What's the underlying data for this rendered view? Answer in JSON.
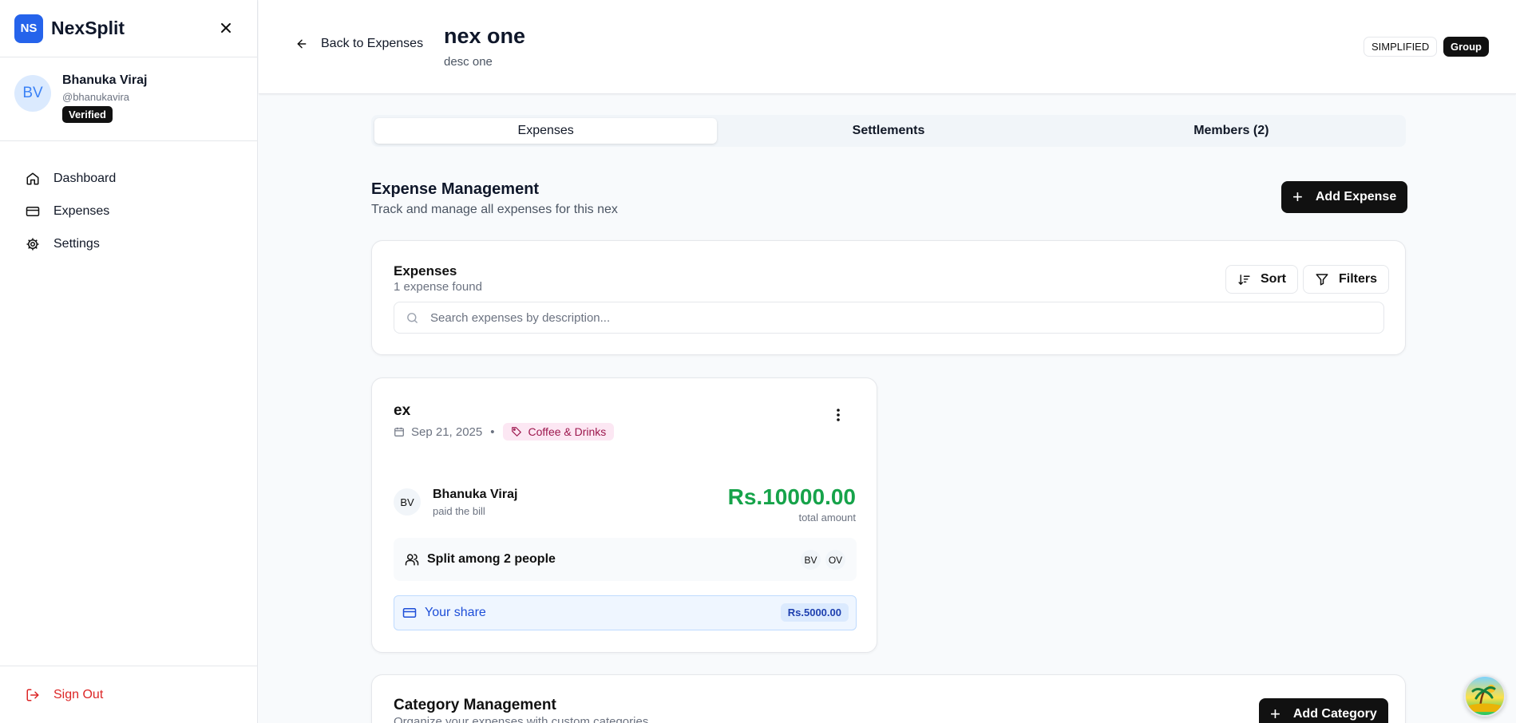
{
  "app": {
    "logo_initials": "NS",
    "name": "NexSplit"
  },
  "user": {
    "initials": "BV",
    "name": "Bhanuka Viraj",
    "handle": "@bhanukavira",
    "badge": "Verified"
  },
  "nav": {
    "items": [
      {
        "label": "Dashboard",
        "icon": "home-icon"
      },
      {
        "label": "Expenses",
        "icon": "credit-card-icon"
      },
      {
        "label": "Settings",
        "icon": "gear-icon"
      }
    ],
    "signout_label": "Sign Out"
  },
  "header": {
    "back_label": "Back to Expenses",
    "title": "nex one",
    "description": "desc one",
    "badge_mode": "SIMPLIFIED",
    "badge_type": "Group"
  },
  "tabs": [
    {
      "label": "Expenses",
      "active": true
    },
    {
      "label": "Settlements",
      "active": false
    },
    {
      "label": "Members (2)",
      "active": false
    }
  ],
  "expense_section": {
    "title": "Expense Management",
    "subtitle": "Track and manage all expenses for this nex",
    "add_label": "Add Expense"
  },
  "expenses_panel": {
    "title": "Expenses",
    "count": "1 expense found",
    "sort_label": "Sort",
    "filters_label": "Filters",
    "search_placeholder": "Search expenses by description..."
  },
  "expense": {
    "title": "ex",
    "date": "Sep 21, 2025",
    "separator": "•",
    "category": "Coffee & Drinks",
    "payer_initials": "BV",
    "payer_name": "Bhanuka Viraj",
    "payer_note": "paid the bill",
    "amount": "Rs.10000.00",
    "amount_note": "total amount",
    "split_label": "Split among 2 people",
    "split_members": [
      "BV",
      "OV"
    ],
    "share_label": "Your share",
    "share_amount": "Rs.5000.00"
  },
  "category_section": {
    "title": "Category Management",
    "subtitle": "Organize your expenses with custom categories",
    "add_label": "Add Category"
  },
  "colors": {
    "brand": "#2563eb",
    "amount": "#16a34a",
    "signout": "#dc2626",
    "category_tag_bg": "#fce7f3",
    "share_bg": "#eff6ff"
  }
}
